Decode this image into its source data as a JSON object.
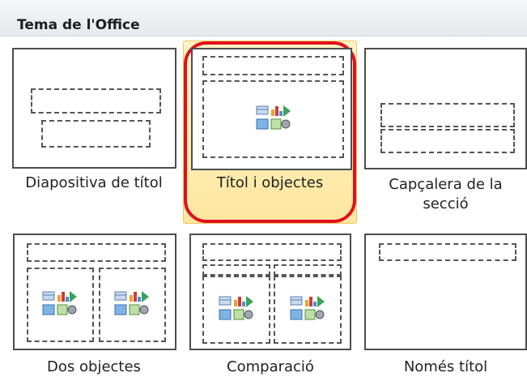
{
  "gallery": {
    "heading": "Tema de l'Office",
    "selected_index": 1,
    "layouts": [
      {
        "label": "Diapositiva de títol"
      },
      {
        "label": "Títol i objectes"
      },
      {
        "label": "Capçalera de la secció"
      },
      {
        "label": "Dos objectes"
      },
      {
        "label": "Comparació"
      },
      {
        "label": "Només títol"
      }
    ]
  },
  "colors": {
    "selection_fill": "#fde7a0",
    "selection_ring": "#e0101e"
  }
}
